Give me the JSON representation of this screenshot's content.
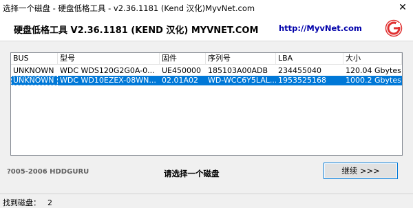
{
  "window": {
    "title": "选择一个磁盘 - 硬盘低格工具 - v2.36.1181 (Kend 汉化)MyvNet.com",
    "close_glyph": "✕"
  },
  "header": {
    "app_name": "硬盘低格工具 V2.36.1181 (KEND 汉化) MYVNET.COM",
    "link": "http://MyvNet.com",
    "logo_icon": "hddguru-logo-icon",
    "logo_color": "#e03030"
  },
  "list": {
    "columns": [
      "BUS",
      "型号",
      "固件",
      "序列号",
      "LBA",
      "大小"
    ],
    "rows": [
      [
        "UNKNOWN",
        "WDC WDS120G2G0A-0...",
        "UE450000",
        "185103A00ADB",
        "234455040",
        "120.04 Gbytes"
      ],
      [
        "UNKNOWN",
        "WDC WD10EZEX-08WN...",
        "02.01A02",
        "WD-WCC6Y5LAL...",
        "1953525168",
        "1000.2 Gbytes"
      ]
    ],
    "selected_row": 1,
    "selection_color": "#0078d7"
  },
  "footer": {
    "copyright": "?005-2006 HDDGURU",
    "prompt": "请选择一个磁盘",
    "continue_label": "继续 >>>"
  },
  "status": {
    "label": "找到磁盘：",
    "count": "2"
  }
}
